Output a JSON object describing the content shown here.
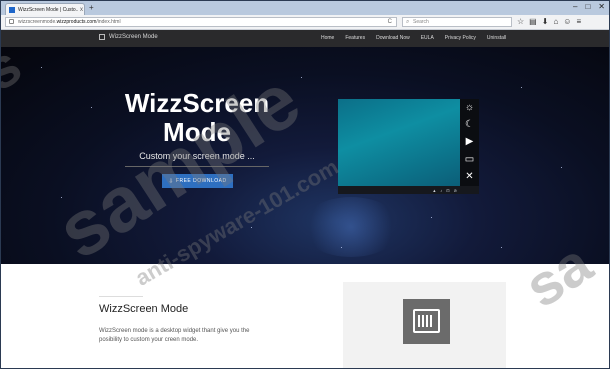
{
  "browser": {
    "tab_title": "WizzScreen Mode | Custo...",
    "tab_close": "x",
    "new_tab": "+",
    "url_prefix": "wizzscreenmode.",
    "url_domain": "wizzproducts.com",
    "url_path": "/index.html",
    "reload": "C",
    "search_placeholder": "Search",
    "toolbar_icons": [
      "☆",
      "▤",
      "⬇",
      "⌂",
      "☺",
      "≡"
    ],
    "window_controls": [
      "–",
      "□",
      "✕"
    ]
  },
  "site": {
    "brand": "WizzScreen Mode",
    "nav": [
      "Home",
      "Features",
      "Download Now",
      "EULA",
      "Privacy Policy",
      "Uninstall"
    ]
  },
  "hero": {
    "title_line1": "WizzScreen",
    "title_line2": "Mode",
    "subtitle": "Custom your screen mode ...",
    "button_label": "FREE DOWNLOAD",
    "button_icon": "⇩",
    "widget_icons": [
      "☼",
      "☾",
      "▶",
      "▭",
      "✕"
    ],
    "taskbar_icons": [
      "▲",
      "♪",
      "⊡",
      "⊘"
    ]
  },
  "section": {
    "heading": "WizzScreen Mode",
    "body": "WizzScreen mode is a desktop widget thant give you the posibility to custom your creen mode."
  },
  "watermark": {
    "large": "sample",
    "small": "anti-spyware-101.com",
    "right": "sa",
    "left": "s"
  },
  "colors": {
    "accent": "#2e6fc0",
    "header": "#2a2a2c",
    "screen_wallpaper": "#0e8ea2"
  }
}
